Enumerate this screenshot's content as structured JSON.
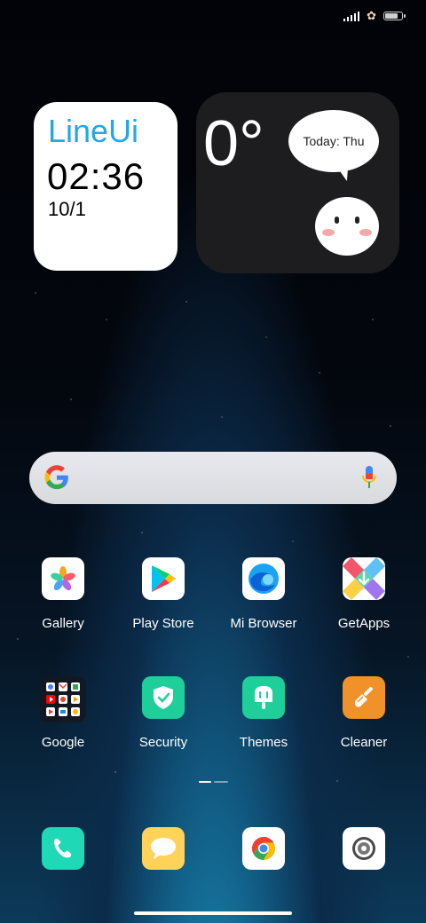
{
  "status_bar": {
    "icons": [
      "signal-icon",
      "flower-icon",
      "battery-icon"
    ]
  },
  "clock_widget": {
    "brand": "LineUi",
    "time": "02:36",
    "date": "10/1",
    "brand_color": "#22a7e8"
  },
  "weather_widget": {
    "temperature": "0°",
    "bubble_text": "Today: Thu"
  },
  "search_bar": {
    "icons": [
      "google-g-icon",
      "microphone-icon"
    ]
  },
  "apps": [
    {
      "label": "Gallery",
      "icon": "gallery-icon"
    },
    {
      "label": "Play Store",
      "icon": "play-store-icon"
    },
    {
      "label": "Mi Browser",
      "icon": "mi-browser-icon"
    },
    {
      "label": "GetApps",
      "icon": "getapps-icon"
    },
    {
      "label": "Google",
      "icon": "google-folder-icon"
    },
    {
      "label": "Security",
      "icon": "security-shield-icon",
      "color": "#1fcf9a"
    },
    {
      "label": "Themes",
      "icon": "themes-icon",
      "color": "#1fcf9a"
    },
    {
      "label": "Cleaner",
      "icon": "cleaner-brush-icon",
      "color": "#f0912a"
    }
  ],
  "page_indicator": {
    "pages": 2,
    "current": 1
  },
  "dock": [
    {
      "icon": "phone-icon",
      "color": "#1ed8b6"
    },
    {
      "icon": "messages-icon",
      "color": "#ffd35a"
    },
    {
      "icon": "chrome-icon",
      "color": "#ffffff"
    },
    {
      "icon": "camera-icon",
      "color": "#ffffff"
    }
  ]
}
